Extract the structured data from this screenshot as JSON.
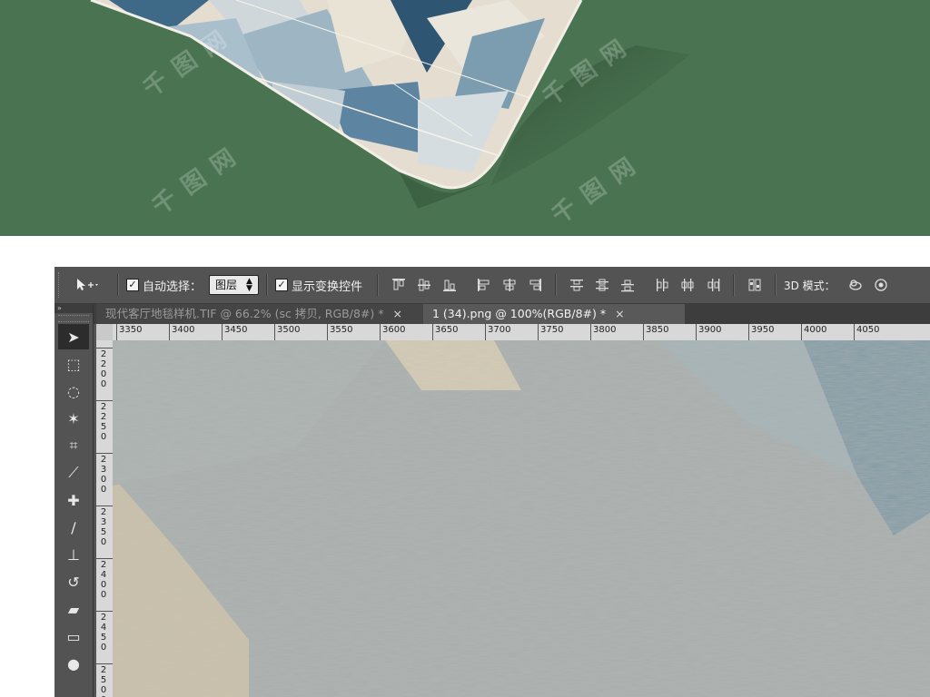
{
  "photoshop": {
    "options_bar": {
      "auto_select_label": "自动选择：",
      "auto_select_checked": "✓",
      "layer_select_value": "图层",
      "show_transform_label": "显示变换控件",
      "show_transform_checked": "✓",
      "mode_3d_label": "3D 模式："
    },
    "tabs": [
      {
        "label": "现代客厅地毯样机.TIF @ 66.2% (sc 拷贝, RGB/8#) *",
        "close": "×",
        "active": false
      },
      {
        "label": "1 (34).png @ 100%(RGB/8#) *",
        "close": "×",
        "active": true
      }
    ],
    "panel_collapse_label": "»",
    "ruler_h_labels": [
      "3350",
      "3400",
      "3450",
      "3500",
      "3550",
      "3600",
      "3650",
      "3700",
      "3750",
      "3800",
      "3850",
      "3900",
      "3950",
      "4000",
      "4050"
    ],
    "ruler_v_labels": [
      "2200",
      "2250",
      "2300",
      "2350",
      "2400",
      "2450",
      "2500"
    ],
    "tools": [
      {
        "name": "move-tool",
        "glyph": "➤",
        "active": true
      },
      {
        "name": "marquee-tool",
        "glyph": "⬚"
      },
      {
        "name": "lasso-tool",
        "glyph": "◌"
      },
      {
        "name": "magic-wand-tool",
        "glyph": "✶"
      },
      {
        "name": "crop-tool",
        "glyph": "⌗"
      },
      {
        "name": "eyedropper-tool",
        "glyph": "⟋"
      },
      {
        "name": "healing-brush-tool",
        "glyph": "✚"
      },
      {
        "name": "brush-tool",
        "glyph": "∕"
      },
      {
        "name": "clone-stamp-tool",
        "glyph": "⊥"
      },
      {
        "name": "history-brush-tool",
        "glyph": "↺"
      },
      {
        "name": "eraser-tool",
        "glyph": "▰"
      },
      {
        "name": "gradient-tool",
        "glyph": "▭"
      },
      {
        "name": "blur-tool",
        "glyph": "●"
      }
    ]
  },
  "colors": {
    "background_green": "#4a7451",
    "ps_panel": "#535353",
    "canvas_texture": "#a9acaa",
    "accent_blue": "#557a93",
    "accent_cream": "#e6dcc8"
  }
}
